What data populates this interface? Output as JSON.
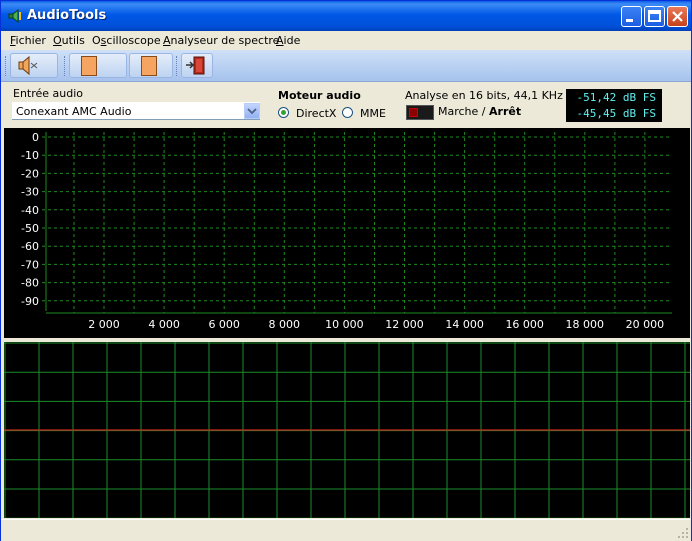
{
  "window": {
    "title": "AudioTools"
  },
  "menu": [
    {
      "label": "Fichier",
      "key": "F",
      "rest": "ichier"
    },
    {
      "label": "Outils",
      "key": "O",
      "rest": "utils"
    },
    {
      "label": "Oscilloscope",
      "key": "s",
      "pre": "O",
      "rest": "cilloscope"
    },
    {
      "label": "Analyseur de spectre",
      "key": "A",
      "rest": "nalyseur de spectre"
    },
    {
      "label": "Aide",
      "key": "A",
      "rest": "ide"
    }
  ],
  "input": {
    "label": "Entrée audio",
    "device": "Conexant AMC Audio"
  },
  "engine": {
    "label": "Moteur audio",
    "options": [
      "DirectX",
      "MME"
    ],
    "selected": "DirectX"
  },
  "analysis": {
    "info": "Analyse en 16 bits, 44,1 KHz",
    "toggle_on": "Marche",
    "toggle_sep": " / ",
    "toggle_off": "Arrêt"
  },
  "levels": {
    "left": "-51,42 dB FS",
    "right": "-45,45 dB FS"
  },
  "spectrum": {
    "y_ticks": [
      "0",
      "-10",
      "-20",
      "-30",
      "-40",
      "-50",
      "-60",
      "-70",
      "-80",
      "-90"
    ],
    "x_ticks": [
      "2 000",
      "4 000",
      "6 000",
      "8 000",
      "10 000",
      "12 000",
      "14 000",
      "16 000",
      "18 000",
      "20 000"
    ],
    "colors": {
      "background": "#000000",
      "grid": "#1e8a1e",
      "text": "#ffffff"
    }
  },
  "oscilloscope": {
    "colors": {
      "background": "#000000",
      "grid": "#1c8c2a",
      "trace": "#c0281e"
    }
  },
  "icons": {
    "app": "audio-icon",
    "mute": "speaker-mute-icon",
    "exit": "exit-door-icon"
  }
}
